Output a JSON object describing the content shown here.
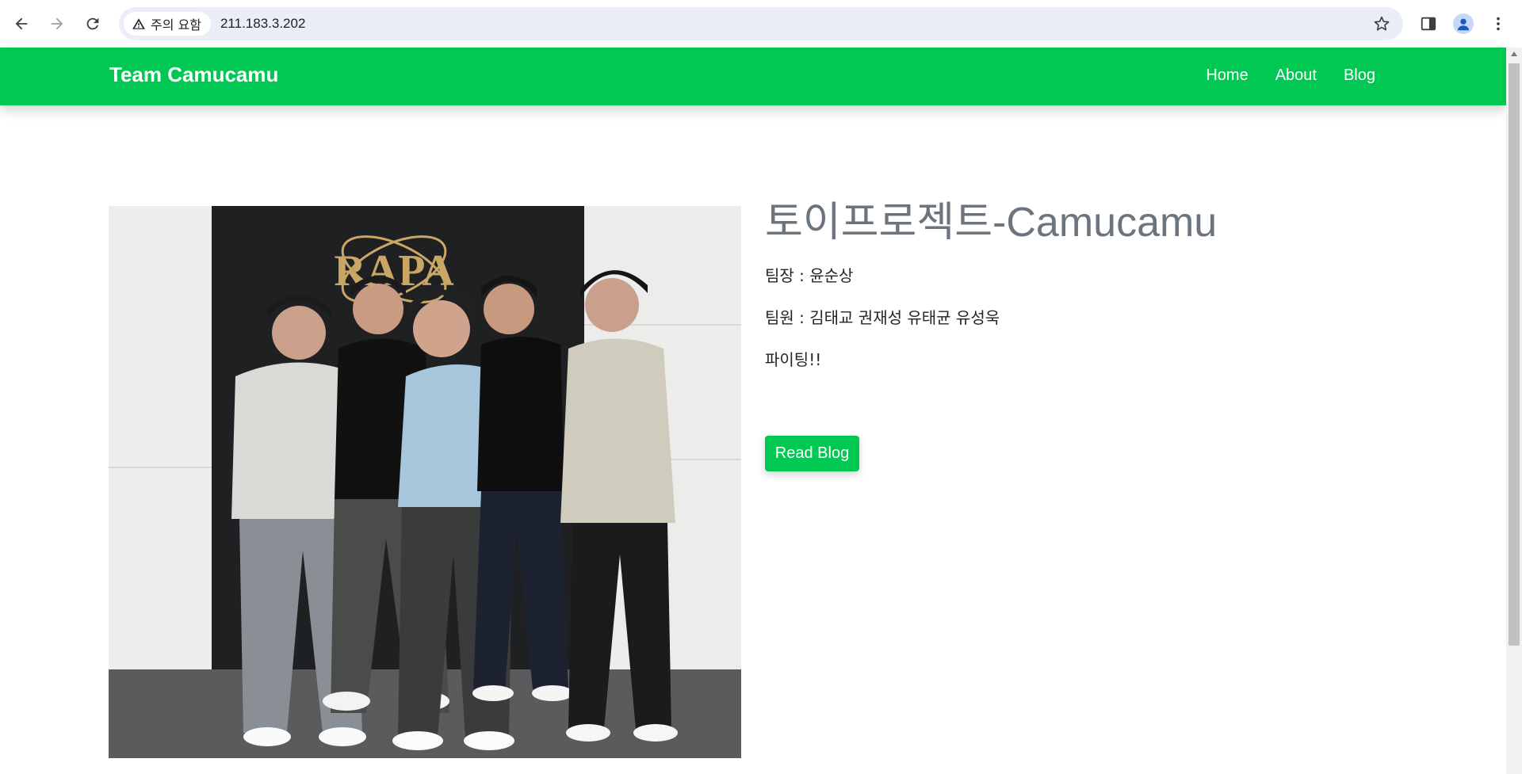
{
  "browser": {
    "security_label": "주의 요함",
    "url": "211.183.3.202"
  },
  "site": {
    "brand": "Team Camucamu",
    "nav": [
      {
        "label": "Home"
      },
      {
        "label": "About"
      },
      {
        "label": "Blog"
      }
    ]
  },
  "main": {
    "title": "토이프로젝트-Camucamu",
    "leader": "팀장 : 윤순상",
    "members": "팀원 : 김태교 권재성 유태균 유성욱",
    "cheer": "파이팅!!",
    "read_button": "Read Blog",
    "photo_sign": "RAPA"
  },
  "colors": {
    "accent": "#00c853",
    "title_gray": "#6c757d"
  }
}
